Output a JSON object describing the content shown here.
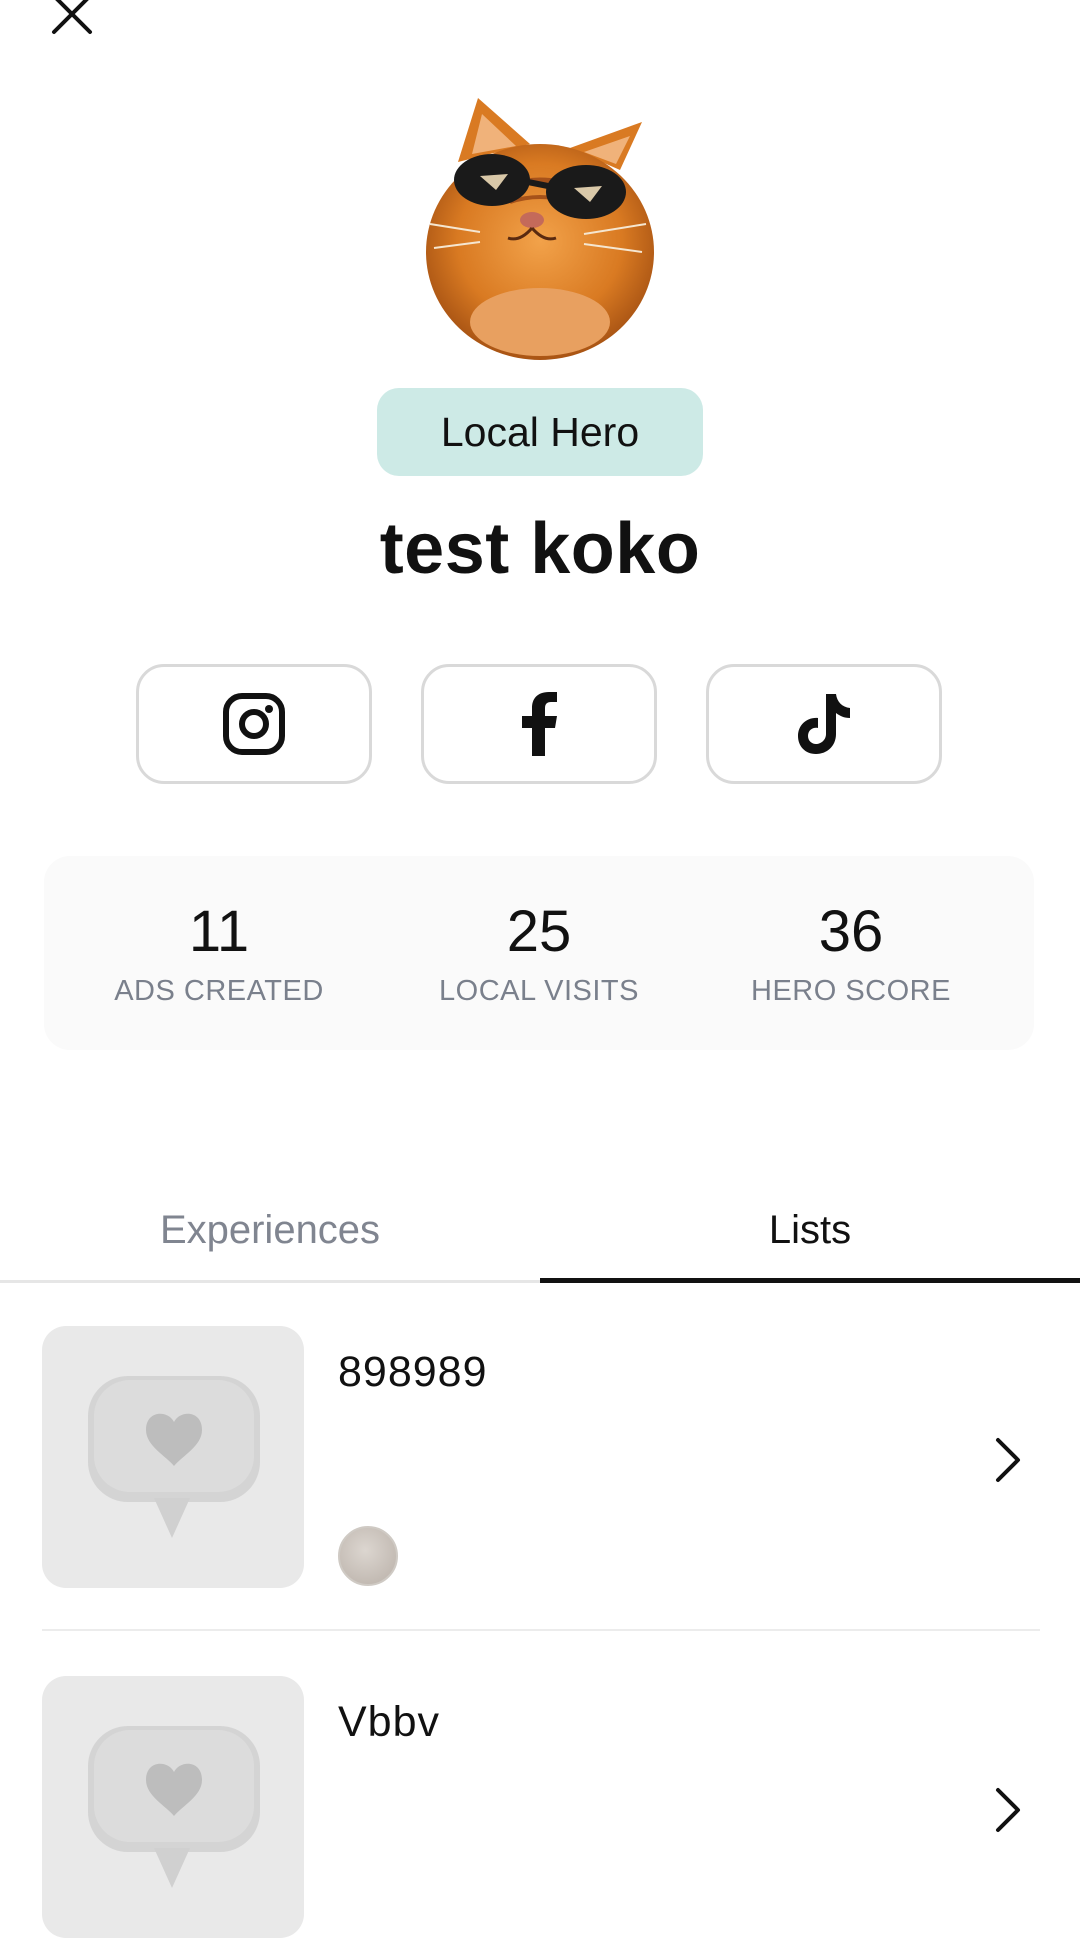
{
  "header": {
    "close_icon": "close-icon"
  },
  "profile": {
    "avatar_icon": "cat-with-sunglasses-avatar",
    "badge": "Local Hero",
    "name": "test koko",
    "badge_color": "#cdeae6"
  },
  "social": [
    {
      "icon": "instagram-icon"
    },
    {
      "icon": "facebook-icon"
    },
    {
      "icon": "tiktok-icon"
    }
  ],
  "stats": [
    {
      "value": "11",
      "label": "ADS CREATED"
    },
    {
      "value": "25",
      "label": "LOCAL VISITS"
    },
    {
      "value": "36",
      "label": "HERO SCORE"
    }
  ],
  "tabs": [
    {
      "label": "Experiences",
      "active": false
    },
    {
      "label": "Lists",
      "active": true
    }
  ],
  "lists": [
    {
      "title": "898989",
      "thumb_icon": "heart-speech-bubble-icon"
    },
    {
      "title": "Vbbv",
      "thumb_icon": "heart-speech-bubble-icon"
    }
  ]
}
